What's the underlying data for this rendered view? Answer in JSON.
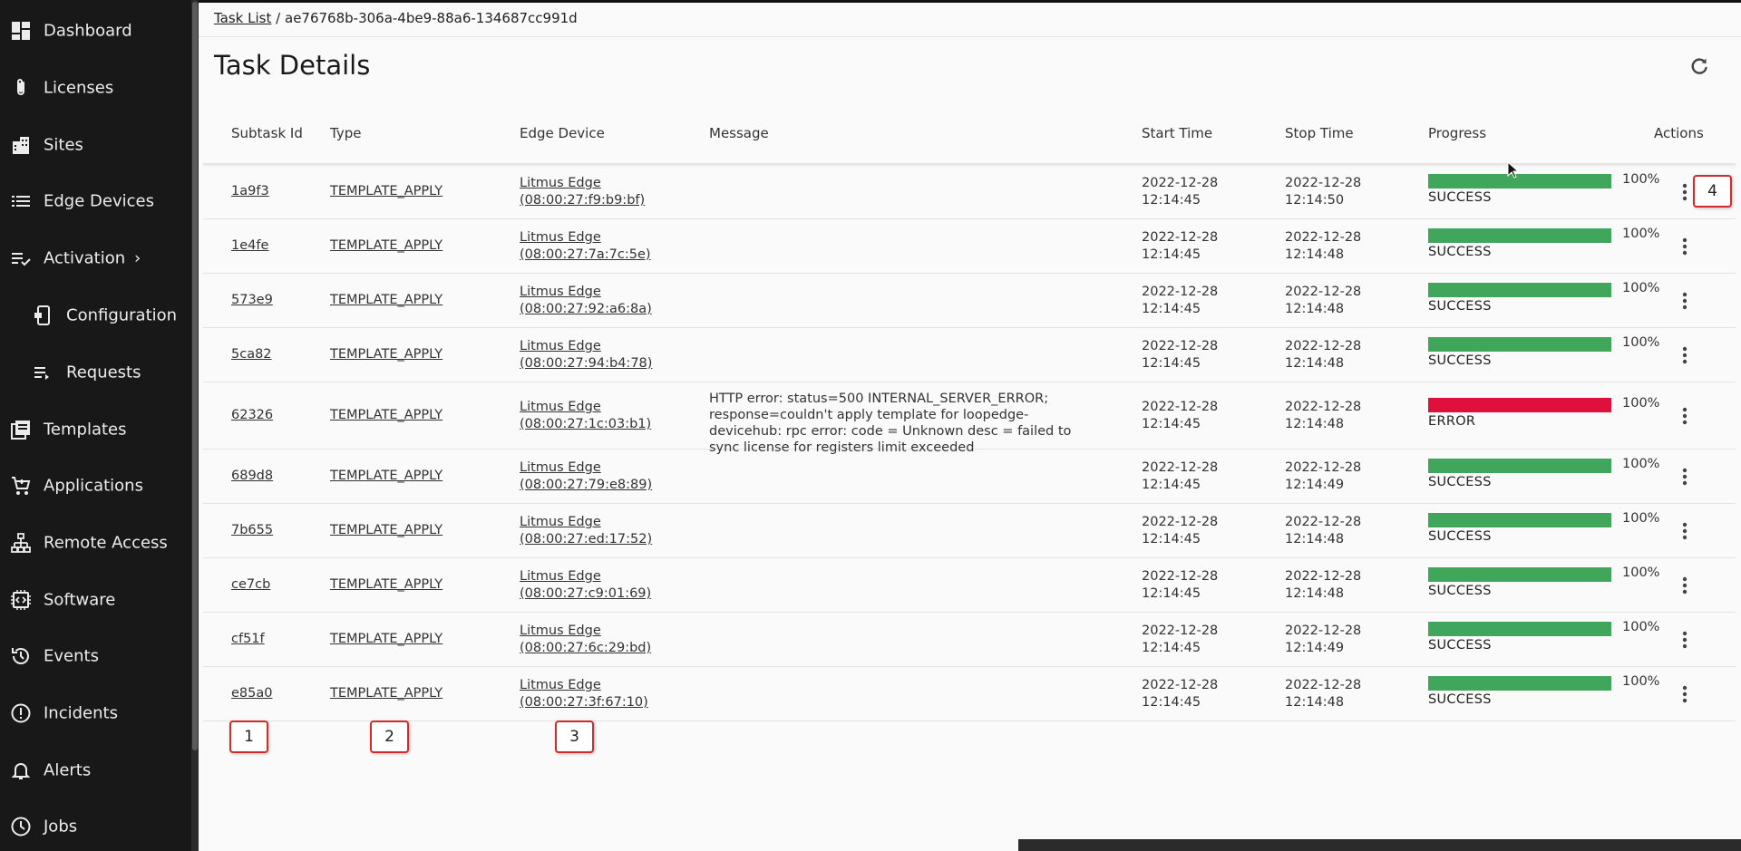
{
  "sidebar": {
    "items": [
      {
        "label": "Dashboard",
        "icon": "dashboard-icon"
      },
      {
        "label": "Licenses",
        "icon": "paperclip-icon"
      },
      {
        "label": "Sites",
        "icon": "building-icon"
      },
      {
        "label": "Edge Devices",
        "icon": "list-icon"
      },
      {
        "label": "Activation",
        "icon": "checklist-icon"
      },
      {
        "label": "Configuration",
        "icon": "device-config-icon"
      },
      {
        "label": "Requests",
        "icon": "requests-list-icon"
      },
      {
        "label": "Templates",
        "icon": "templates-icon"
      },
      {
        "label": "Applications",
        "icon": "cart-icon"
      },
      {
        "label": "Remote Access",
        "icon": "network-icon"
      },
      {
        "label": "Software",
        "icon": "chip-icon"
      },
      {
        "label": "Events",
        "icon": "history-icon"
      },
      {
        "label": "Incidents",
        "icon": "alert-circle-icon"
      },
      {
        "label": "Alerts",
        "icon": "bell-icon"
      },
      {
        "label": "Jobs",
        "icon": "clock-icon"
      }
    ],
    "activation_chevron": "›"
  },
  "breadcrumb": {
    "parent": "Task List",
    "separator": "/",
    "current": "ae76768b-306a-4be9-88a6-134687cc991d"
  },
  "page": {
    "title": "Task Details"
  },
  "table": {
    "headers": {
      "subtask_id": "Subtask Id",
      "type": "Type",
      "edge_device": "Edge Device",
      "message": "Message",
      "start_time": "Start Time",
      "stop_time": "Stop Time",
      "progress": "Progress",
      "actions": "Actions"
    },
    "rows": [
      {
        "id": "1a9f3",
        "type": "TEMPLATE_APPLY",
        "device_name": "Litmus Edge",
        "device_mac": "(08:00:27:f9:b9:bf)",
        "message": "",
        "start_date": "2022-12-28",
        "start_time": "12:14:45",
        "stop_date": "2022-12-28",
        "stop_time": "12:14:50",
        "progress": 100,
        "progress_label": "100%",
        "status": "SUCCESS"
      },
      {
        "id": "1e4fe",
        "type": "TEMPLATE_APPLY",
        "device_name": "Litmus Edge",
        "device_mac": "(08:00:27:7a:7c:5e)",
        "message": "",
        "start_date": "2022-12-28",
        "start_time": "12:14:45",
        "stop_date": "2022-12-28",
        "stop_time": "12:14:48",
        "progress": 100,
        "progress_label": "100%",
        "status": "SUCCESS"
      },
      {
        "id": "573e9",
        "type": "TEMPLATE_APPLY",
        "device_name": "Litmus Edge",
        "device_mac": "(08:00:27:92:a6:8a)",
        "message": "",
        "start_date": "2022-12-28",
        "start_time": "12:14:45",
        "stop_date": "2022-12-28",
        "stop_time": "12:14:48",
        "progress": 100,
        "progress_label": "100%",
        "status": "SUCCESS"
      },
      {
        "id": "5ca82",
        "type": "TEMPLATE_APPLY",
        "device_name": "Litmus Edge",
        "device_mac": "(08:00:27:94:b4:78)",
        "message": "",
        "start_date": "2022-12-28",
        "start_time": "12:14:45",
        "stop_date": "2022-12-28",
        "stop_time": "12:14:48",
        "progress": 100,
        "progress_label": "100%",
        "status": "SUCCESS"
      },
      {
        "id": "62326",
        "type": "TEMPLATE_APPLY",
        "device_name": "Litmus Edge",
        "device_mac": "(08:00:27:1c:03:b1)",
        "message": "HTTP error: status=500 INTERNAL_SERVER_ERROR; response=couldn't apply template for loopedge-devicehub: rpc error: code = Unknown desc = failed to sync license for registers limit exceeded",
        "start_date": "2022-12-28",
        "start_time": "12:14:45",
        "stop_date": "2022-12-28",
        "stop_time": "12:14:48",
        "progress": 100,
        "progress_label": "100%",
        "status": "ERROR"
      },
      {
        "id": "689d8",
        "type": "TEMPLATE_APPLY",
        "device_name": "Litmus Edge",
        "device_mac": "(08:00:27:79:e8:89)",
        "message": "",
        "start_date": "2022-12-28",
        "start_time": "12:14:45",
        "stop_date": "2022-12-28",
        "stop_time": "12:14:49",
        "progress": 100,
        "progress_label": "100%",
        "status": "SUCCESS"
      },
      {
        "id": "7b655",
        "type": "TEMPLATE_APPLY",
        "device_name": "Litmus Edge",
        "device_mac": "(08:00:27:ed:17:52)",
        "message": "",
        "start_date": "2022-12-28",
        "start_time": "12:14:45",
        "stop_date": "2022-12-28",
        "stop_time": "12:14:48",
        "progress": 100,
        "progress_label": "100%",
        "status": "SUCCESS"
      },
      {
        "id": "ce7cb",
        "type": "TEMPLATE_APPLY",
        "device_name": "Litmus Edge",
        "device_mac": "(08:00:27:c9:01:69)",
        "message": "",
        "start_date": "2022-12-28",
        "start_time": "12:14:45",
        "stop_date": "2022-12-28",
        "stop_time": "12:14:48",
        "progress": 100,
        "progress_label": "100%",
        "status": "SUCCESS"
      },
      {
        "id": "cf51f",
        "type": "TEMPLATE_APPLY",
        "device_name": "Litmus Edge",
        "device_mac": "(08:00:27:6c:29:bd)",
        "message": "",
        "start_date": "2022-12-28",
        "start_time": "12:14:45",
        "stop_date": "2022-12-28",
        "stop_time": "12:14:49",
        "progress": 100,
        "progress_label": "100%",
        "status": "SUCCESS"
      },
      {
        "id": "e85a0",
        "type": "TEMPLATE_APPLY",
        "device_name": "Litmus Edge",
        "device_mac": "(08:00:27:3f:67:10)",
        "message": "",
        "start_date": "2022-12-28",
        "start_time": "12:14:45",
        "stop_date": "2022-12-28",
        "stop_time": "12:14:48",
        "progress": 100,
        "progress_label": "100%",
        "status": "SUCCESS"
      }
    ]
  },
  "annotations": [
    "1",
    "2",
    "3",
    "4"
  ],
  "colors": {
    "success": "#3fa65c",
    "error": "#e0103c",
    "sidebar_bg": "#181818",
    "callout_border": "#d12b2b"
  }
}
